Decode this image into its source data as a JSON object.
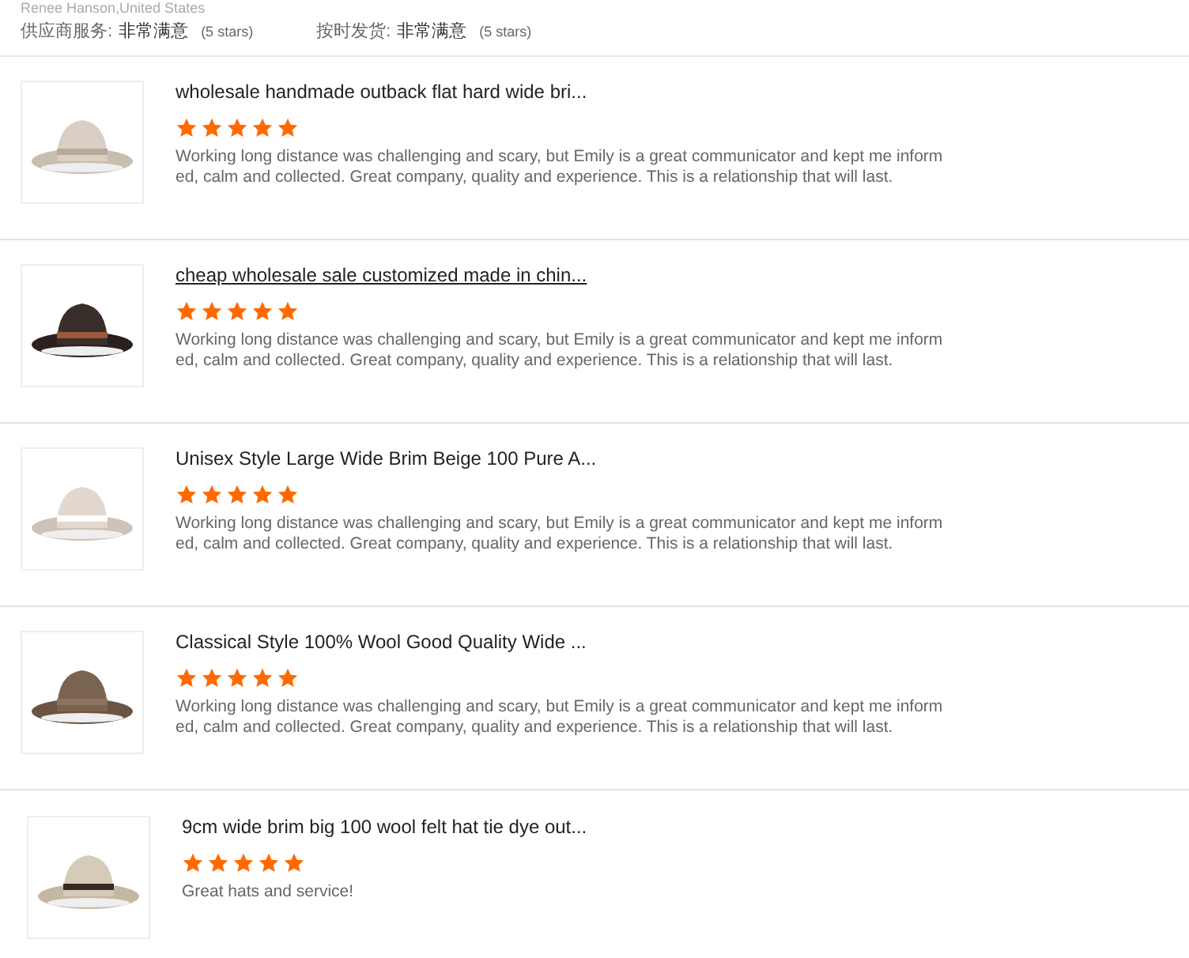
{
  "reviewer": "Renee Hanson,United States",
  "ratings": [
    {
      "label": "供应商服务:",
      "value": "非常满意",
      "stars_text": "(5 stars)"
    },
    {
      "label": "按时发货:",
      "value": "非常满意",
      "stars_text": "(5 stars)"
    }
  ],
  "reviews": [
    {
      "title": "wholesale handmade outback flat hard wide bri...",
      "hovered": false,
      "stars": 5,
      "text": "Working long distance was challenging and scary, but Emily is a great communicator and kept me informed, calm and collected. Great company, quality and experience. This is a relationship that will last."
    },
    {
      "title": "cheap wholesale sale customized made in chin...",
      "hovered": true,
      "stars": 5,
      "text": "Working long distance was challenging and scary, but Emily is a great communicator and kept me informed, calm and collected. Great company, quality and experience. This is a relationship that will last."
    },
    {
      "title": "Unisex Style Large Wide Brim Beige 100 Pure A...",
      "hovered": false,
      "stars": 5,
      "text": "Working long distance was challenging and scary, but Emily is a great communicator and kept me informed, calm and collected. Great company, quality and experience. This is a relationship that will last."
    },
    {
      "title": "Classical Style 100% Wool Good Quality Wide ...",
      "hovered": false,
      "stars": 5,
      "text": "Working long distance was challenging and scary, but Emily is a great communicator and kept me informed, calm and collected. Great company, quality and experience. This is a relationship that will last."
    },
    {
      "title": "9cm wide brim big 100 wool felt hat tie dye out...",
      "hovered": false,
      "stars": 5,
      "text": "Great hats and service!"
    }
  ]
}
